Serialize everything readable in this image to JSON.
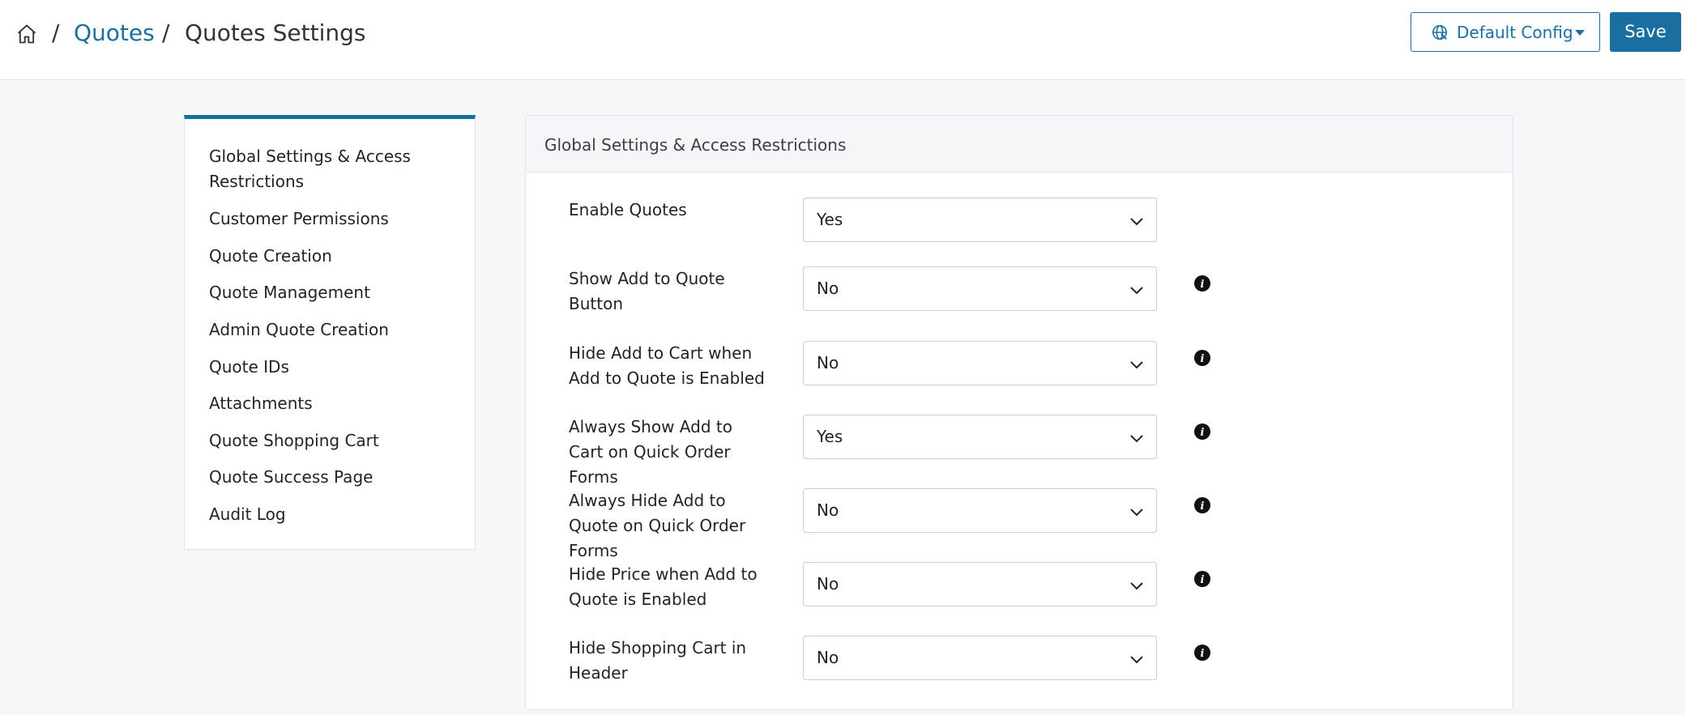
{
  "breadcrumb": {
    "home_icon": "home-icon",
    "separator": "/",
    "parent": "Quotes",
    "current": "Quotes Settings"
  },
  "header": {
    "config_label": "Default Config",
    "save_label": "Save",
    "accent_color": "#1a6fa0"
  },
  "sidebar": {
    "items": [
      {
        "label": "Global Settings & Access Restrictions"
      },
      {
        "label": "Customer Permissions"
      },
      {
        "label": "Quote Creation"
      },
      {
        "label": "Quote Management"
      },
      {
        "label": "Admin Quote Creation"
      },
      {
        "label": "Quote IDs"
      },
      {
        "label": "Attachments"
      },
      {
        "label": "Quote Shopping Cart"
      },
      {
        "label": "Quote Success Page"
      },
      {
        "label": "Audit Log"
      }
    ]
  },
  "panel": {
    "title": "Global Settings & Access Restrictions",
    "fields": [
      {
        "label": "Enable Quotes",
        "value": "Yes",
        "has_info": false
      },
      {
        "label": "Show Add to Quote Button",
        "value": "No",
        "has_info": true
      },
      {
        "label": "Hide Add to Cart when Add to Quote is Enabled",
        "value": "No",
        "has_info": true
      },
      {
        "label": "Always Show Add to Cart on Quick Order Forms",
        "value": "Yes",
        "has_info": true
      },
      {
        "label": "Always Hide Add to Quote on Quick Order Forms",
        "value": "No",
        "has_info": true
      },
      {
        "label": "Hide Price when Add to Quote is Enabled",
        "value": "No",
        "has_info": true
      },
      {
        "label": "Hide Shopping Cart in Header",
        "value": "No",
        "has_info": true
      }
    ]
  }
}
